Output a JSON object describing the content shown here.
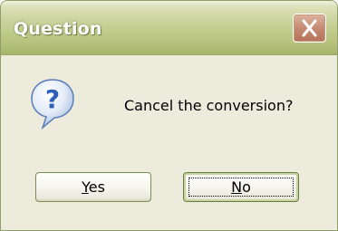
{
  "dialog": {
    "title": "Question",
    "message": "Cancel the conversion?",
    "icon": "question-icon",
    "buttons": {
      "yes": {
        "accel": "Y",
        "rest": "es"
      },
      "no": {
        "accel": "N",
        "rest": "o"
      }
    }
  },
  "colors": {
    "titlebar": "#bfca89",
    "close_button": "#c48a72",
    "dialog_background": "#ecebdc",
    "icon_blue": "#2d5fb8"
  }
}
